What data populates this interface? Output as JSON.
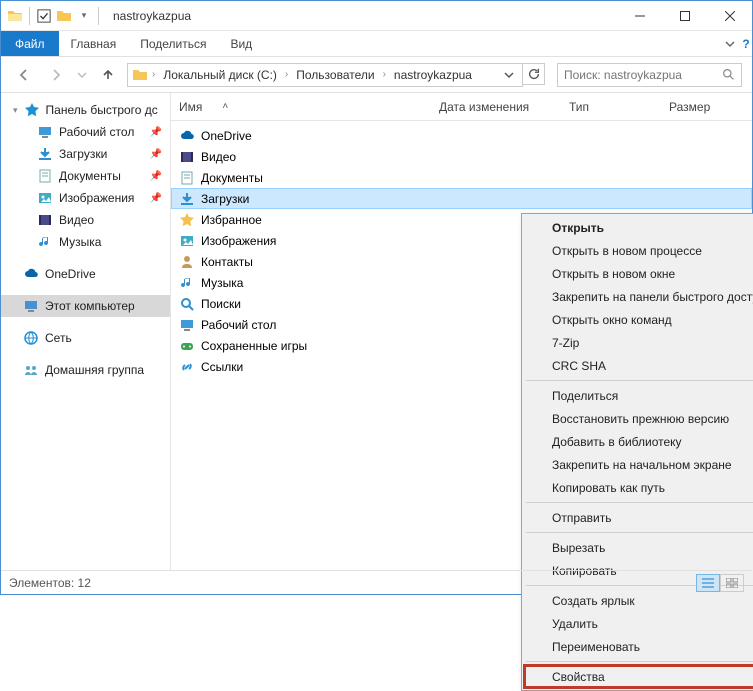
{
  "window": {
    "title": "nastroykazpua"
  },
  "ribbon": {
    "file": "Файл",
    "tabs": [
      "Главная",
      "Поделиться",
      "Вид"
    ]
  },
  "breadcrumbs": [
    "Локальный диск (C:)",
    "Пользователи",
    "nastroykazpua"
  ],
  "search": {
    "placeholder": "Поиск: nastroykazpua"
  },
  "columns": {
    "name": "Имя",
    "date": "Дата изменения",
    "type": "Тип",
    "size": "Размер"
  },
  "navpane": {
    "quick": "Панель быстрого дс",
    "quick_items": [
      {
        "label": "Рабочий стол",
        "pin": true
      },
      {
        "label": "Загрузки",
        "pin": true
      },
      {
        "label": "Документы",
        "pin": true
      },
      {
        "label": "Изображения",
        "pin": true
      },
      {
        "label": "Видео",
        "pin": false
      },
      {
        "label": "Музыка",
        "pin": false
      }
    ],
    "onedrive": "OneDrive",
    "thispc": "Этот компьютер",
    "network": "Сеть",
    "homegroup": "Домашняя группа"
  },
  "files": [
    "OneDrive",
    "Видео",
    "Документы",
    "Загрузки",
    "Избранное",
    "Изображения",
    "Контакты",
    "Музыка",
    "Поиски",
    "Рабочий стол",
    "Сохраненные игры",
    "Ссылки"
  ],
  "files_selected_index": 3,
  "context_menu": {
    "groups": [
      [
        {
          "label": "Открыть",
          "bold": true
        },
        {
          "label": "Открыть в новом процессе"
        },
        {
          "label": "Открыть в новом окне"
        },
        {
          "label": "Закрепить на панели быстрого доступа"
        },
        {
          "label": "Открыть окно команд"
        },
        {
          "label": "7-Zip",
          "sub": true
        },
        {
          "label": "CRC SHA",
          "sub": true
        }
      ],
      [
        {
          "label": "Поделиться",
          "sub": true
        },
        {
          "label": "Восстановить прежнюю версию"
        },
        {
          "label": "Добавить в библиотеку",
          "sub": true
        },
        {
          "label": "Закрепить на начальном экране"
        },
        {
          "label": "Копировать как путь"
        }
      ],
      [
        {
          "label": "Отправить",
          "sub": true
        }
      ],
      [
        {
          "label": "Вырезать"
        },
        {
          "label": "Копировать"
        }
      ],
      [
        {
          "label": "Создать ярлык"
        },
        {
          "label": "Удалить"
        },
        {
          "label": "Переименовать"
        }
      ],
      [
        {
          "label": "Свойства",
          "highlight": true
        }
      ]
    ]
  },
  "status": {
    "text": "Элементов: 12"
  }
}
